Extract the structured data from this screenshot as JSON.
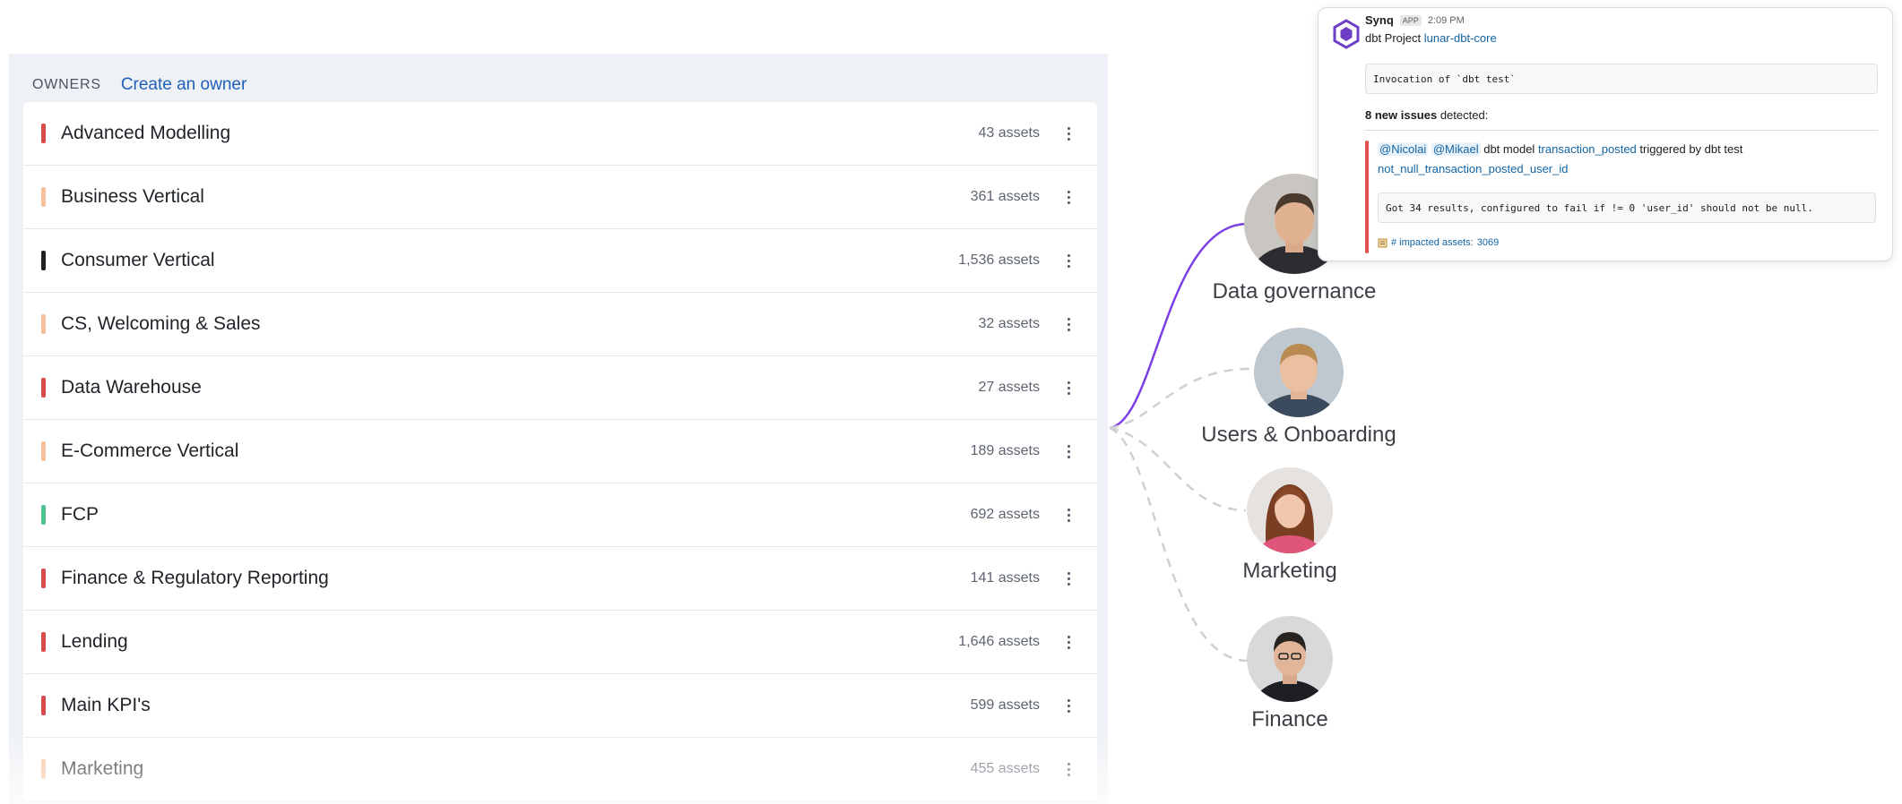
{
  "owners_panel": {
    "heading": "OWNERS",
    "create_link": "Create an owner",
    "rows": [
      {
        "name": "Advanced Modelling",
        "assets": "43 assets",
        "accent": "#d94a4a"
      },
      {
        "name": "Business Vertical",
        "assets": "361 assets",
        "accent": "#f4c19c"
      },
      {
        "name": "Consumer Vertical",
        "assets": "1,536 assets",
        "accent": "#1f2328"
      },
      {
        "name": "CS, Welcoming & Sales",
        "assets": "32 assets",
        "accent": "#f4c19c"
      },
      {
        "name": "Data Warehouse",
        "assets": "27 assets",
        "accent": "#d94a4a"
      },
      {
        "name": "E-Commerce Vertical",
        "assets": "189 assets",
        "accent": "#f4c19c"
      },
      {
        "name": "FCP",
        "assets": "692 assets",
        "accent": "#4fc38f"
      },
      {
        "name": "Finance & Regulatory Reporting",
        "assets": "141 assets",
        "accent": "#d94a4a"
      },
      {
        "name": "Lending",
        "assets": "1,646 assets",
        "accent": "#d94a4a"
      },
      {
        "name": "Main KPI's",
        "assets": "599 assets",
        "accent": "#d94a4a"
      },
      {
        "name": "Marketing",
        "assets": "455 assets",
        "accent": "#f4c19c"
      }
    ]
  },
  "people": [
    {
      "label": "Data governance",
      "icon": "person-avatar-icon"
    },
    {
      "label": "Users & Onboarding",
      "icon": "person-avatar-icon"
    },
    {
      "label": "Marketing",
      "icon": "person-avatar-icon"
    },
    {
      "label": "Finance",
      "icon": "person-avatar-icon"
    }
  ],
  "slack": {
    "bot_name": "Synq",
    "badge": "APP",
    "time": "2:09 PM",
    "project_prefix": "dbt Project ",
    "project_name": "lunar-dbt-core",
    "invocation": "Invocation of `dbt test`",
    "issues_count": "8 new issues",
    "issues_suffix": " detected:",
    "mention1": "@Nicolai",
    "mention2": "@Mikael",
    "model_prefix": " dbt model ",
    "model_name": "transaction_posted",
    "trigger_text": " triggered by dbt test",
    "test_name": "not_null_transaction_posted_user_id",
    "result": "Got 34 results, configured to fail if != 0 'user_id' should not be null.",
    "impact_label": "# impacted assets: ",
    "impact_count": "3069"
  },
  "colors": {
    "accent_link": "#1f5fb8",
    "active_connector": "#7b3fe4",
    "inactive_connector": "#cfcfd4",
    "alert_red": "#e05252"
  }
}
